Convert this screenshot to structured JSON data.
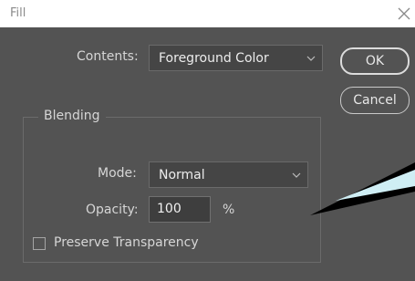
{
  "window": {
    "title": "Fill",
    "close_icon": "close-icon"
  },
  "contents": {
    "label": "Contents:",
    "value": "Foreground Color"
  },
  "buttons": {
    "ok": "OK",
    "cancel": "Cancel"
  },
  "blending": {
    "legend": "Blending",
    "mode_label": "Mode:",
    "mode_value": "Normal",
    "opacity_label": "Opacity:",
    "opacity_value": "100",
    "opacity_unit": "%",
    "preserve_label": "Preserve Transparency",
    "preserve_checked": false
  },
  "colors": {
    "panel": "#535353",
    "field": "#454545",
    "callout_fill": "#cfeef4",
    "callout_outline": "#000000"
  }
}
